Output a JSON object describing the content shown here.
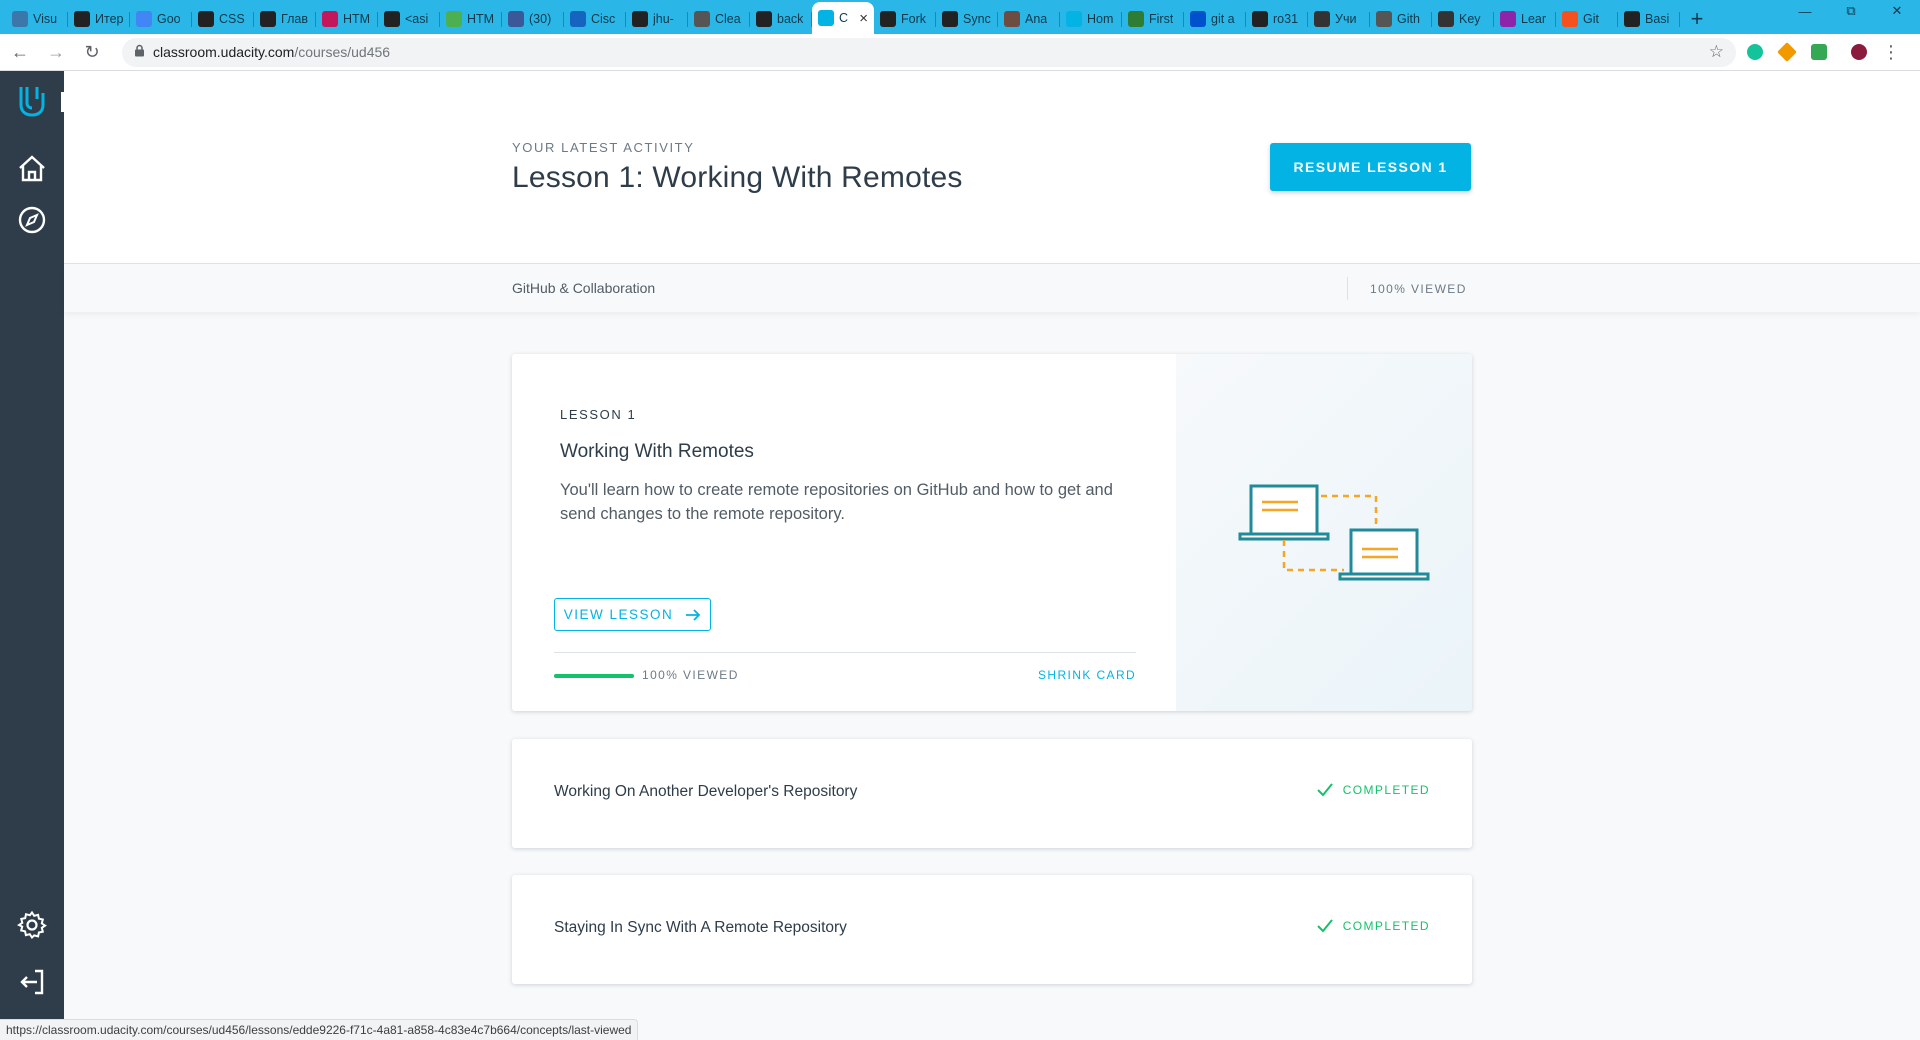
{
  "browser": {
    "tabs": [
      {
        "title": "Visu",
        "icon": "python-icon",
        "color": "#3b77a8"
      },
      {
        "title": "Итер",
        "icon": "circle-slash-icon",
        "color": "#222222"
      },
      {
        "title": "Goo",
        "icon": "translate-icon",
        "color": "#4285f4"
      },
      {
        "title": "CSS",
        "icon": "html-academy-icon",
        "color": "#222222"
      },
      {
        "title": "Глав",
        "icon": "shield-icon",
        "color": "#222222"
      },
      {
        "title": "HTM",
        "icon": "htmlacademy-icon",
        "color": "#c2185b"
      },
      {
        "title": "<asi",
        "icon": "bird-icon",
        "color": "#222222"
      },
      {
        "title": "HTM",
        "icon": "w3-icon",
        "color": "#4caf50"
      },
      {
        "title": "(30)",
        "icon": "facebook-icon",
        "color": "#3b5998"
      },
      {
        "title": "Cisc",
        "icon": "link-icon",
        "color": "#1565c0"
      },
      {
        "title": "jhu-",
        "icon": "github-icon",
        "color": "#222222"
      },
      {
        "title": "Clea",
        "icon": "bulb-icon",
        "color": "#555555"
      },
      {
        "title": "back",
        "icon": "github-icon",
        "color": "#222222"
      },
      {
        "title": "C",
        "icon": "udacity-icon",
        "color": "#02b3e4"
      },
      {
        "title": "Fork",
        "icon": "github-icon",
        "color": "#222222"
      },
      {
        "title": "Sync",
        "icon": "github-icon",
        "color": "#222222"
      },
      {
        "title": "Ana",
        "icon": "photo-icon",
        "color": "#6d4c41"
      },
      {
        "title": "Hom",
        "icon": "udacity-icon",
        "color": "#02b3e4"
      },
      {
        "title": "First",
        "icon": "pr-icon",
        "color": "#2e7d32"
      },
      {
        "title": "git a",
        "icon": "atlassian-icon",
        "color": "#0052cc"
      },
      {
        "title": "ro31",
        "icon": "github-icon",
        "color": "#222222"
      },
      {
        "title": "Учи",
        "icon": "doc-icon",
        "color": "#333333"
      },
      {
        "title": "Gith",
        "icon": "mail-icon",
        "color": "#555555"
      },
      {
        "title": "Key",
        "icon": "octocat-icon",
        "color": "#333333"
      },
      {
        "title": "Lear",
        "icon": "octocat-icon",
        "color": "#8e24aa"
      },
      {
        "title": "Git",
        "icon": "git-icon",
        "color": "#f4511e"
      },
      {
        "title": "Basi",
        "icon": "github-icon",
        "color": "#222222"
      }
    ],
    "active_tab_index": 13,
    "new_tab_label": "+",
    "url_host": "classroom.udacity.com",
    "url_path": "/courses/ud456",
    "status_url": "https://classroom.udacity.com/courses/ud456/lessons/edde9226-f71c-4a81-a858-4c83e4c7b664/concepts/last-viewed"
  },
  "sidebar": {
    "items": [
      {
        "name": "udacity-logo-icon"
      },
      {
        "name": "home-icon"
      },
      {
        "name": "compass-icon"
      },
      {
        "name": "settings-gear-icon"
      },
      {
        "name": "logout-icon"
      }
    ]
  },
  "hero": {
    "eyebrow": "YOUR LATEST ACTIVITY",
    "title": "Lesson 1: Working With Remotes",
    "resume_label": "RESUME LESSON 1"
  },
  "part_bar": {
    "title": "GitHub & Collaboration",
    "viewed": "100% VIEWED"
  },
  "lesson_card": {
    "number_label": "LESSON 1",
    "title": "Working With Remotes",
    "description": "You'll learn how to create remote repositories on GitHub and how to get and send changes to the remote repository.",
    "view_label": "VIEW LESSON",
    "progress_fraction": 1.0,
    "progress_label": "100% VIEWED",
    "shrink_label": "SHRINK CARD",
    "colors": {
      "progress": "#15c26b",
      "accent": "#02b3e4",
      "illus_teal": "#1f8a9a",
      "illus_orange": "#f5a623"
    }
  },
  "lessons": [
    {
      "title": "Working On Another Developer's Repository",
      "status": "COMPLETED"
    },
    {
      "title": "Staying In Sync With A Remote Repository",
      "status": "COMPLETED"
    }
  ],
  "colors": {
    "sidebar": "#2e3d49",
    "primary": "#02b3e4",
    "success": "#15c26b",
    "tabstrip": "#2bb6e8"
  }
}
